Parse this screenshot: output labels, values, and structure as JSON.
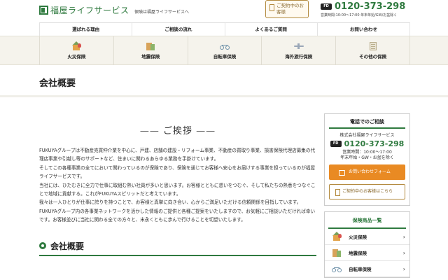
{
  "header": {
    "logo_text": "福屋ライフサービス",
    "tagline": "保険は福屋ライフサービスへ",
    "contract_button": "ご契約中のお客様",
    "free_dial_label": "FD",
    "phone": "0120-373-298",
    "hours": "営業時間:10:00～17:00 年末年始/GW/お盆除く"
  },
  "nav": {
    "items": [
      "選ばれる理由",
      "ご相談の流れ",
      "よくあるご質問",
      "お問い合わせ"
    ]
  },
  "products": {
    "items": [
      {
        "label": "火災保険",
        "icon": "house-fire-icon"
      },
      {
        "label": "地震保険",
        "icon": "earthquake-icon"
      },
      {
        "label": "自転車保険",
        "icon": "bicycle-icon"
      },
      {
        "label": "海外旅行保険",
        "icon": "airplane-icon"
      },
      {
        "label": "その他の保険",
        "icon": "document-icon"
      }
    ]
  },
  "page": {
    "title": "会社概要"
  },
  "greeting": {
    "heading": "ご挨拶",
    "paragraphs": [
      "FUKUYAグループは不動産売買仲介業を中心に、戸建、店舗の建設・リフォーム事業、不動産の買取り事業、損害保険代理店募集の代理店事業や引越し等のサポートなど、住まいに関わるあらゆる業務を手掛けています。",
      "そしてこの各種事業の全てにおいて関わっているのが保険であり、保険を通じてお客様へ安心をお届けする事業を担っているのが福屋ライフサービスです。",
      "当社には、ひたむきに全力で仕事に取組む熱い社員が多いと思います。お客様とともに想いをつむぐ、そして私たちの熱意をつなぐことで地域に貢献する。これがFUKUYAスピリットだと考えています。",
      "我々は一人ひとりが仕事に誇りを持つことで、お客様と真摯に向き合い、心からご満足いただける信頼関係を目指しています。",
      "FUKUYAグループ内の各事業ネットワークを活かした情報のご提供と各種ご提案をいたしますので、お気軽にご相談いただければ幸いです。お客様並びに当社に関わる全ての方々と、末永くともに歩んで行けることを切望いたします。"
    ]
  },
  "company_section": {
    "heading": "会社概要"
  },
  "sidebar": {
    "contact": {
      "title": "電話でのご相談",
      "company": "株式会社福屋ライフサービス",
      "phone": "0120-373-298",
      "hours_line1": "営業時間：10:00～17:00",
      "hours_line2": "年末年始・GW・お盆を除く",
      "form_button": "お問い合わせフォーム",
      "contract_button": "ご契約中のお客様はこちら"
    },
    "plans": {
      "title": "保険商品一覧",
      "items": [
        {
          "label": "火災保険",
          "icon": "house-fire-icon"
        },
        {
          "label": "地震保険",
          "icon": "earthquake-icon"
        },
        {
          "label": "自転車保険",
          "icon": "bicycle-icon"
        }
      ]
    }
  },
  "colors": {
    "brand_green": "#2f7a3f",
    "accent_orange": "#e98a23",
    "gold": "#b38a3e"
  }
}
